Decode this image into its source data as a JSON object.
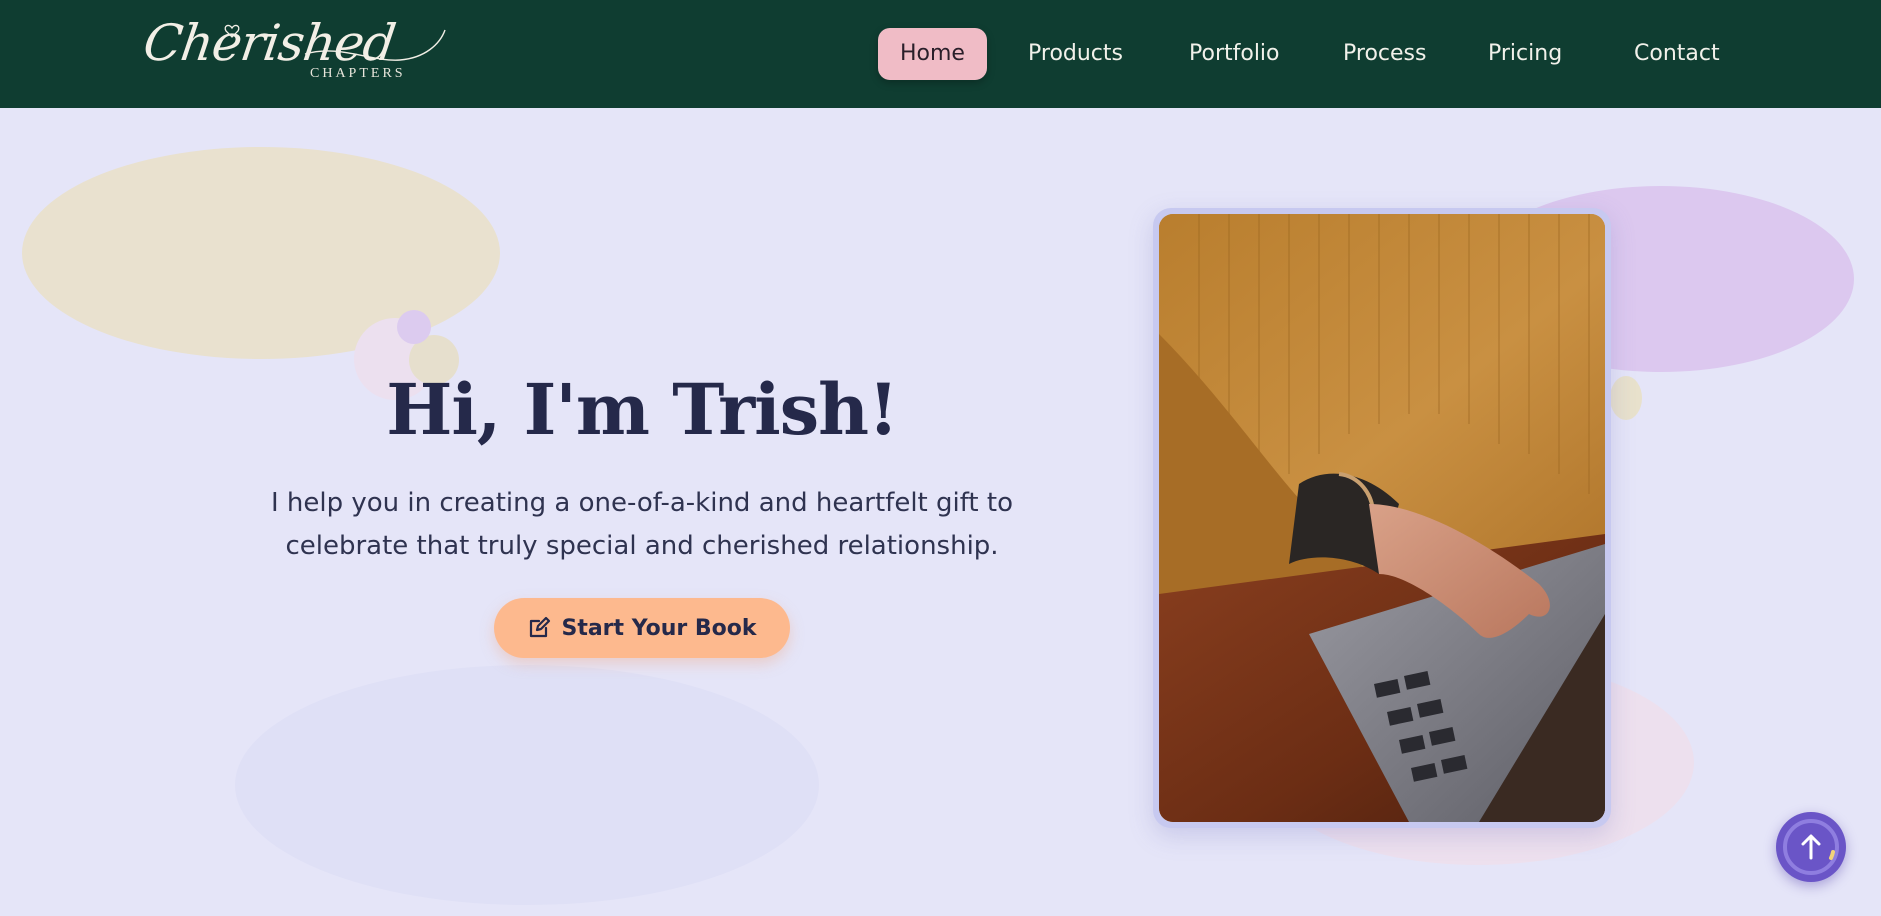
{
  "header": {
    "logo": {
      "script_text": "Cherished",
      "sub_text": "CHAPTERS"
    },
    "nav": [
      {
        "label": "Home",
        "active": true
      },
      {
        "label": "Products",
        "active": false
      },
      {
        "label": "Portfolio",
        "active": false
      },
      {
        "label": "Process",
        "active": false
      },
      {
        "label": "Pricing",
        "active": false
      },
      {
        "label": "Contact",
        "active": false
      }
    ]
  },
  "hero": {
    "title": "Hi, I'm Trish!",
    "subtitle_line1": "I help you in creating a one-of-a-kind and heartfelt gift to",
    "subtitle_line2": "celebrate that truly special and cherished relationship.",
    "cta": {
      "label": "Start Your Book",
      "icon": "edit-icon"
    }
  },
  "photo": {
    "icon": "person-typing-on-laptop-photo"
  },
  "scroll_top": {
    "icon": "arrow-up-icon"
  },
  "colors": {
    "header_bg": "#0f3d31",
    "page_bg": "#e5e5f8",
    "nav_active_bg": "#f0bcc6",
    "cta_bg": "#fdb98e",
    "title_color": "#25294a",
    "scroll_top_bg": "#6a55c7"
  }
}
